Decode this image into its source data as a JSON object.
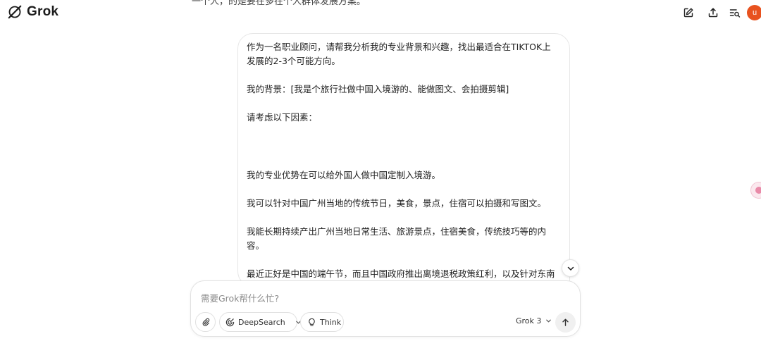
{
  "app": {
    "name": "Grok"
  },
  "thread": {
    "previous_message_fragment": "一个人，的是要在多在个人群体发展方案。"
  },
  "user_message": {
    "paragraphs": [
      "作为一名职业顾问，请帮我分析我的专业背景和兴趣，找出最适合在TIKTOK上发展的2-3个可能方向。",
      "我的背景：[我是个旅行社做中国入境游的、能做图文、会拍摄剪辑]",
      "请考虑以下因素：",
      "我的专业优势在可以给外国人做中国定制入境游。",
      "我可以针对中国广州当地的传统节日，美食，景点，住宿可以拍摄和写图文。",
      "我能长期持续产出广州当地日常生活、旅游景点，住宿美食，传统技巧等的内容。",
      "最近正好是中国的端午节，而且中国政府推出离境退税政策红利，以及针对东南亚国家的免签政策。"
    ]
  },
  "header": {
    "avatar_initial": "u"
  },
  "composer": {
    "placeholder": "需要Grok帮什么忙?",
    "deepsearch_label": "DeepSearch",
    "think_label": "Think",
    "model_label": "Grok 3"
  },
  "icons": {
    "logo": "grok-logo-icon",
    "new_chat": "edit-icon",
    "share": "upload-icon",
    "history": "search-history-icon",
    "attach": "paperclip-icon",
    "deepsearch": "deepsearch-icon",
    "think": "lightbulb-icon",
    "send": "arrow-up-icon",
    "scroll": "chevron-down-icon"
  },
  "colors": {
    "avatar_bg": "#e8521f",
    "border": "#e2e2e2",
    "text": "#1f1f1f"
  }
}
